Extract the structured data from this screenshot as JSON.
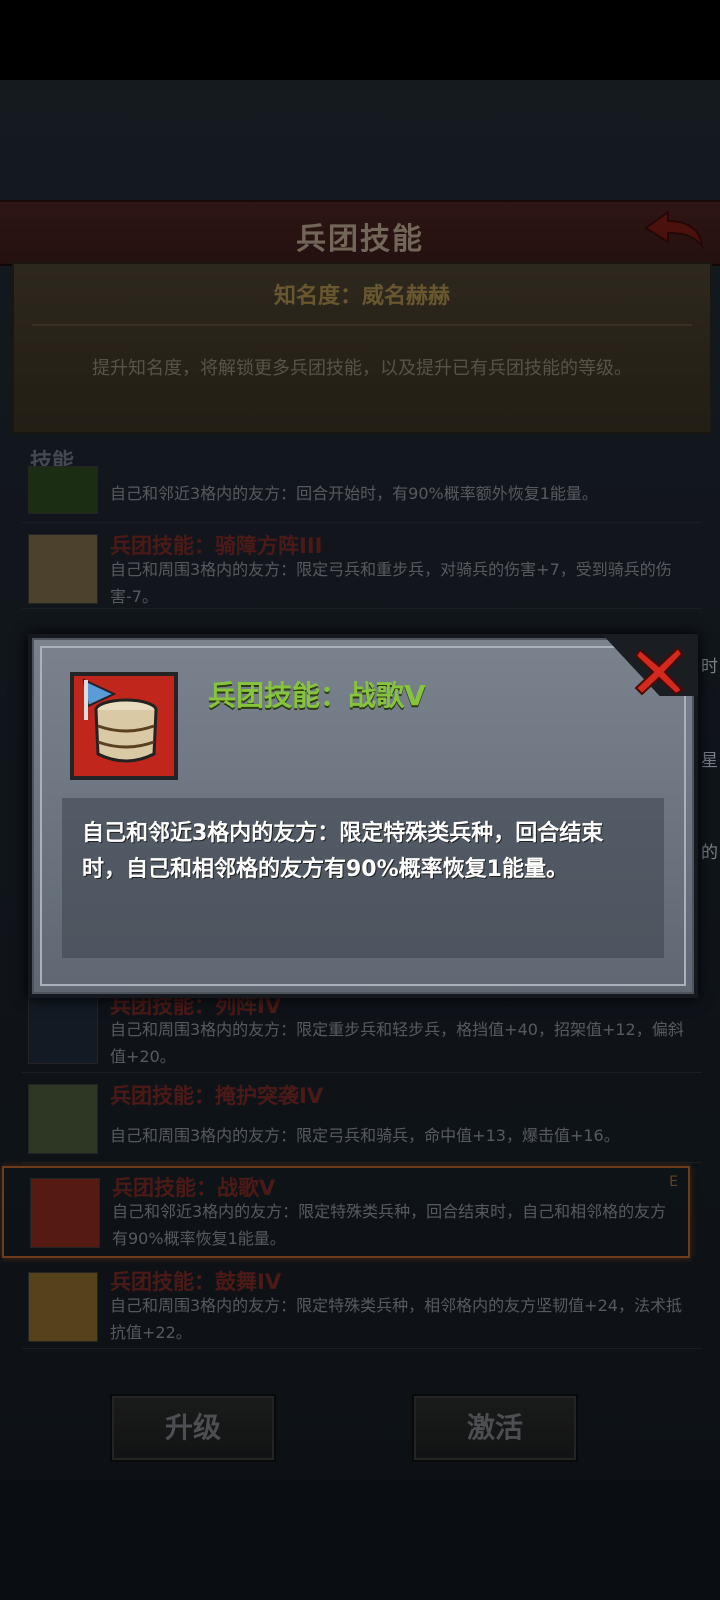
{
  "header": {
    "title": "兵团技能"
  },
  "fame": {
    "title": "知名度：威名赫赫",
    "description": "提升知名度，将解锁更多兵团技能，以及提升已有兵团技能的等级。"
  },
  "section_label": "技能",
  "skills": [
    {
      "name": "",
      "desc": "自己和邻近3格内的友方：回合开始时，有90%概率额外恢复1能量。"
    },
    {
      "name": "兵团技能：骑障方阵III",
      "desc": "自己和周围3格内的友方：限定弓兵和重步兵，对骑兵的伤害+7，受到骑兵的伤害-7。"
    },
    {
      "name": "兵团技能：列阵IV",
      "desc": "自己和周围3格内的友方：限定重步兵和轻步兵，格挡值+40，招架值+12，偏斜值+20。"
    },
    {
      "name": "兵团技能：掩护突袭IV",
      "desc": "自己和周围3格内的友方：限定弓兵和骑兵，命中值+13，爆击值+16。"
    },
    {
      "name": "兵团技能：战歌V",
      "desc": "自己和邻近3格内的友方：限定特殊类兵种，回合结束时，自己和相邻格的友方有90%概率恢复1能量。",
      "mark": "E"
    },
    {
      "name": "兵团技能：鼓舞IV",
      "desc": "自己和周围3格内的友方：限定特殊类兵种，相邻格内的友方坚韧值+24，法术抵抗值+22。"
    }
  ],
  "side_notes": [
    "时",
    "星",
    "的"
  ],
  "buttons": {
    "upgrade": "升级",
    "activate": "激活"
  },
  "modal": {
    "title": "兵团技能：战歌V",
    "description": "自己和邻近3格内的友方：限定特殊类兵种，回合结束时，自己和相邻格的友方有90%概率恢复1能量。",
    "icon": "war-drum-icon",
    "close_icon": "close-icon"
  },
  "colors": {
    "skill_name_red": "#7a2a24",
    "modal_title_green": "#86c43c",
    "selected_border": "#b0622a",
    "close_red": "#d42a1e"
  }
}
